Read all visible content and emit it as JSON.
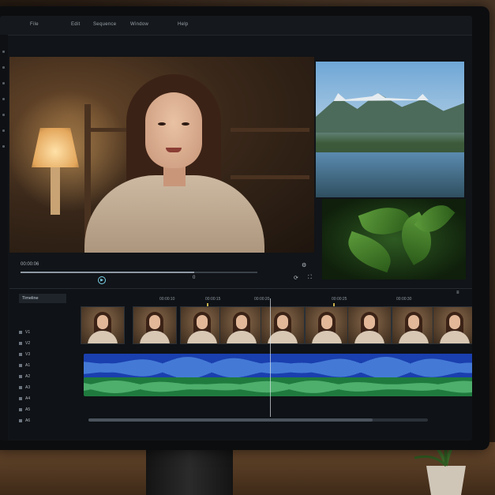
{
  "menubar": {
    "items": [
      "File",
      "Edit",
      "Sequence",
      "Window",
      "Help"
    ]
  },
  "preview": {
    "timecode": "00:00:06",
    "playhead_time": "0"
  },
  "timeline": {
    "panel_title": "Timeline",
    "ruler_labels": [
      "00:00:10",
      "00:00:15",
      "00:00:20",
      "00:00:25",
      "00:00:30"
    ],
    "tracks": [
      "V1",
      "V2",
      "V3",
      "A1",
      "A2",
      "A3",
      "A4",
      "A5",
      "A6"
    ]
  },
  "colors": {
    "accent": "#7ad0e6",
    "audio_track_1": "#1a3fae",
    "audio_track_2": "#1f7a3e",
    "marker": "#c9b24b"
  }
}
